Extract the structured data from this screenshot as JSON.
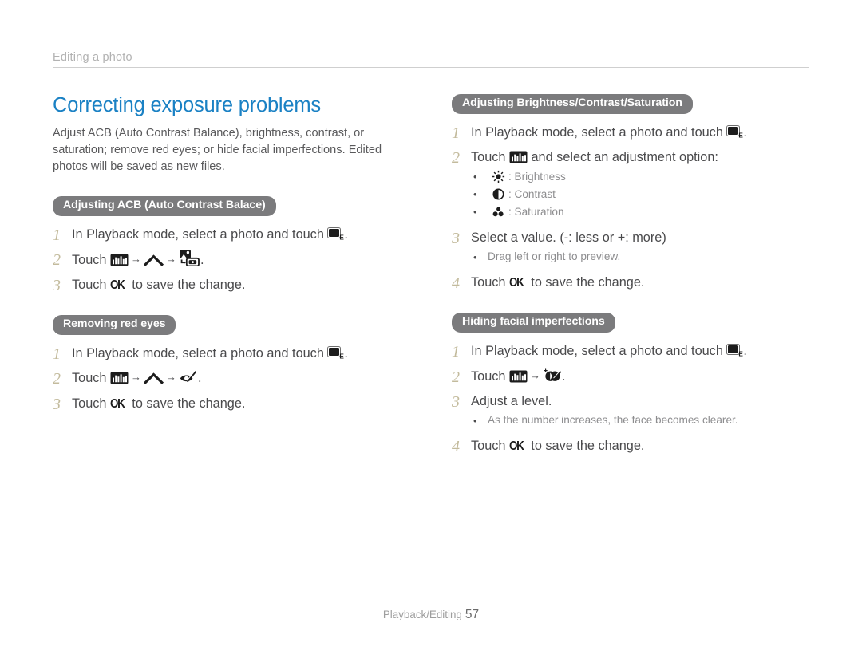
{
  "document": {
    "running_header": "Editing a photo",
    "footer_section": "Playback/Editing",
    "footer_page": "57",
    "colors": {
      "title_blue": "#1a81c4",
      "pill_gray": "#7b7b7d",
      "step_number_tan": "#c3bb9d",
      "body_text": "#4a4a4c",
      "muted_text": "#8d8d8f"
    }
  },
  "main": {
    "title": "Correcting exposure problems",
    "intro": "Adjust ACB (Auto Contrast Balance), brightness, contrast, or saturation; remove red eyes; or hide facial imperfections. Edited photos will be saved as new files."
  },
  "sections": {
    "acb": {
      "heading": "Adjusting ACB (Auto Contrast Balace)",
      "steps": [
        {
          "num": "1",
          "pre": "In Playback mode, select a photo and touch ",
          "post": "."
        },
        {
          "num": "2",
          "pre": "Touch ",
          "post": "."
        },
        {
          "num": "3",
          "pre": "Touch ",
          "mid": " to save the change.",
          "ok": "OK"
        }
      ]
    },
    "redeye": {
      "heading": "Removing red eyes",
      "steps": [
        {
          "num": "1",
          "pre": "In Playback mode, select a photo and touch ",
          "post": "."
        },
        {
          "num": "2",
          "pre": "Touch ",
          "post": "."
        },
        {
          "num": "3",
          "pre": "Touch ",
          "mid": " to save the change.",
          "ok": "OK"
        }
      ]
    },
    "bcs": {
      "heading": "Adjusting Brightness/Contrast/Saturation",
      "steps": [
        {
          "num": "1",
          "pre": "In Playback mode, select a photo and touch ",
          "post": "."
        },
        {
          "num": "2",
          "pre": "Touch ",
          "post": " and select an adjustment option:"
        },
        {
          "num": "3",
          "text": "Select a value. (-: less or +: more)"
        },
        {
          "num": "4",
          "pre": "Touch ",
          "mid": " to save the change.",
          "ok": "OK"
        }
      ],
      "options": [
        {
          "icon": "brightness-sun-icon",
          "label": ": Brightness"
        },
        {
          "icon": "contrast-half-circle-icon",
          "label": ": Contrast"
        },
        {
          "icon": "saturation-dots-icon",
          "label": ": Saturation"
        }
      ],
      "note": "Drag left or right to preview."
    },
    "facial": {
      "heading": "Hiding facial imperfections",
      "steps": [
        {
          "num": "1",
          "pre": "In Playback mode, select a photo and touch ",
          "post": "."
        },
        {
          "num": "2",
          "pre": "Touch ",
          "post": "."
        },
        {
          "num": "3",
          "text": "Adjust a level."
        },
        {
          "num": "4",
          "pre": "Touch ",
          "mid": " to save the change.",
          "ok": "OK"
        }
      ],
      "note": "As the number increases, the face becomes clearer."
    }
  },
  "icons": {
    "playback_edit": "photo-edit-mode-icon",
    "menu": "menu-histogram-icon",
    "up_caret": "up-caret-icon",
    "acb": "acb-icon",
    "redeye": "red-eye-removal-icon",
    "face_retouch": "face-retouch-icon",
    "arrow": "→",
    "bullet": "•"
  }
}
